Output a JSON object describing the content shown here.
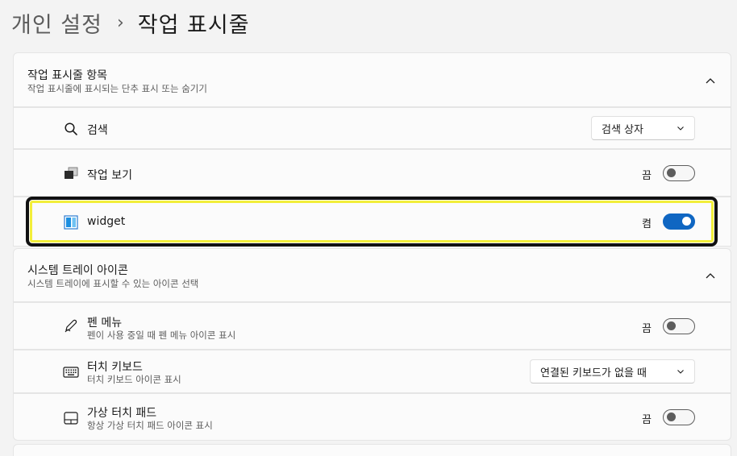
{
  "breadcrumb": {
    "parent": "개인 설정",
    "separator": "›",
    "current": "작업 표시줄"
  },
  "taskbar_items": {
    "title": "작업 표시줄 항목",
    "subtitle": "작업 표시줄에 표시되는 단추 표시 또는 숨기기",
    "expanded": true,
    "items": [
      {
        "label": "검색",
        "icon": "search-icon",
        "control": "dropdown",
        "value": "검색 상자"
      },
      {
        "label": "작업 보기",
        "icon": "task-view-icon",
        "control": "toggle",
        "state_label": "끔",
        "on": false
      },
      {
        "label": "widget",
        "icon": "widgets-icon",
        "control": "toggle",
        "state_label": "켬",
        "on": true,
        "highlighted": true
      }
    ]
  },
  "system_tray": {
    "title": "시스템 트레이 아이콘",
    "subtitle": "시스템 트레이에 표시할 수 있는 아이콘 선택",
    "expanded": true,
    "items": [
      {
        "label": "펜 메뉴",
        "description": "펜이 사용 중일 때 펜 메뉴 아이콘 표시",
        "icon": "pen-icon",
        "control": "toggle",
        "state_label": "끔",
        "on": false
      },
      {
        "label": "터치 키보드",
        "description": "터치 키보드 아이콘 표시",
        "icon": "keyboard-icon",
        "control": "dropdown",
        "value": "연결된 키보드가 없을 때"
      },
      {
        "label": "가상 터치 패드",
        "description": "항상 가상 터치 패드 아이콘 표시",
        "icon": "touchpad-icon",
        "control": "toggle",
        "state_label": "끔",
        "on": false
      }
    ]
  },
  "colors": {
    "accent": "#0f66c2",
    "highlight_yellow": "#f2ee3a",
    "background": "#f3f3f3",
    "card": "#fbfbfb"
  }
}
